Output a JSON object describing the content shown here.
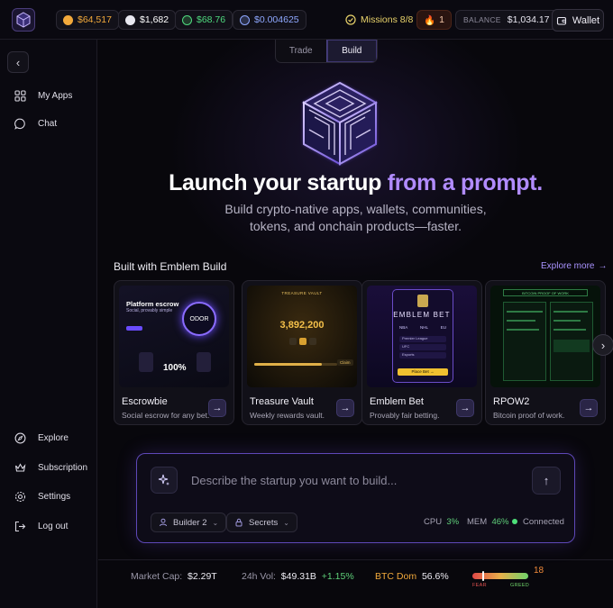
{
  "topbar": {
    "tickers": [
      {
        "symbol": "BTC",
        "value": "$64,517",
        "color": "#f2a93b"
      },
      {
        "symbol": "ETH",
        "value": "$1,682",
        "color": "#ffffff"
      },
      {
        "symbol": "USDT",
        "value": "$68.76",
        "color": "#4fd97e"
      },
      {
        "symbol": "TOKEN",
        "value": "$0.004625",
        "color": "#8fa8ff"
      }
    ],
    "missions": "Missions 8/8",
    "streak": "1",
    "balance_label": "BALANCE",
    "balance_value": "$1,034.17",
    "wallet_label": "Wallet"
  },
  "sidebar": {
    "top_items": [
      {
        "label": "My Apps",
        "icon": "grid-icon"
      },
      {
        "label": "Chat",
        "icon": "chat-icon"
      }
    ],
    "bottom_items": [
      {
        "label": "Explore",
        "icon": "compass-icon"
      },
      {
        "label": "Subscription",
        "icon": "crown-icon"
      },
      {
        "label": "Settings",
        "icon": "gear-icon"
      },
      {
        "label": "Log out",
        "icon": "logout-icon"
      }
    ]
  },
  "tabs": [
    {
      "label": "Trade",
      "active": false
    },
    {
      "label": "Build",
      "active": true
    }
  ],
  "hero": {
    "headline_main": "Launch your startup ",
    "headline_accent": "from a prompt.",
    "sub_line1": "Build crypto-native apps, wallets, communities,",
    "sub_line2": "tokens, and onchain products—faster."
  },
  "built": {
    "title": "Built with Emblem Build",
    "explore_more": "Explore more",
    "cards": [
      {
        "title": "Escrowbie",
        "desc": "Social escrow for any bet.",
        "thumb_heading": "Platform escrow",
        "thumb_sub": "Social, provably simple",
        "thumb_badge": "ODOR",
        "thumb_value": "100%"
      },
      {
        "title": "Treasure Vault",
        "desc": "Weekly rewards vault.",
        "thumb_heading": "TREASURE VAULT",
        "thumb_value": "3,892,200",
        "thumb_btn": "Claim"
      },
      {
        "title": "Emblem Bet",
        "desc": "Provably fair betting.",
        "thumb_heading": "EMBLEM BET",
        "thumb_items": [
          "NBA",
          "NHL",
          "EU"
        ],
        "thumb_rows": [
          "Premier League",
          "UFC",
          "Esports"
        ],
        "thumb_btn": "Place Bet →"
      },
      {
        "title": "RPOW2",
        "desc": "Bitcoin proof of work.",
        "thumb_heading": "BITCOIN PROOF OF WORK"
      }
    ]
  },
  "prompt": {
    "placeholder": "Describe the startup you want to build...",
    "builder": "Builder 2",
    "secrets": "Secrets",
    "cpu_label": "CPU",
    "cpu_value": "3%",
    "mem_label": "MEM",
    "mem_value": "46%",
    "status": "Connected"
  },
  "market": {
    "cap_label": "Market Cap:",
    "cap_value": "$2.29T",
    "vol_label": "24h Vol:",
    "vol_value": "$49.31B",
    "vol_change": "+1.15%",
    "dom_label": "BTC Dom",
    "dom_value": "56.6%",
    "fear_label": "FEAR",
    "greed_label": "GREED",
    "fear_greed_value": "18"
  },
  "colors": {
    "accent": "#b18cff",
    "positive": "#5fd07a",
    "background": "#08070c"
  }
}
